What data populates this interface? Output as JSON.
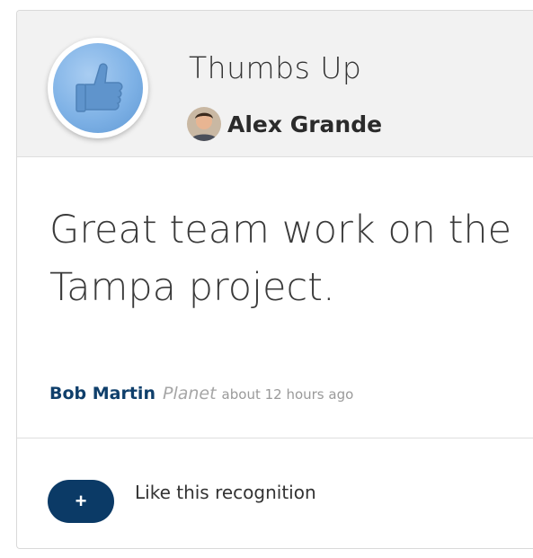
{
  "award": {
    "title": "Thumbs Up",
    "icon": "thumbs-up-icon",
    "badge_color": "#7fb2e6"
  },
  "giver": {
    "name": "Alex Grande"
  },
  "recognition": {
    "message": "Great team work on the Tampa project.",
    "recipient": "Bob Martin",
    "team": "Planet",
    "time": "about 12 hours ago"
  },
  "like": {
    "button_label": "+",
    "label": "Like this recognition",
    "button_color": "#0b3a66"
  }
}
